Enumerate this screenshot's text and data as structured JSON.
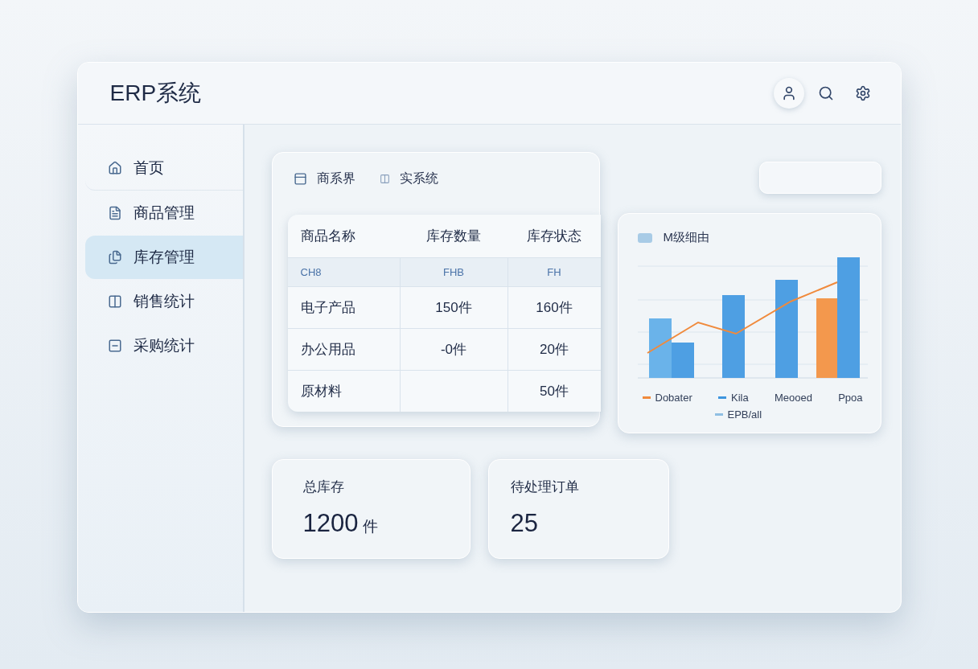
{
  "window": {
    "title": "ERP系统"
  },
  "sidebar": {
    "items": [
      {
        "label": "首页",
        "selected": false
      },
      {
        "label": "商品管理",
        "selected": false
      },
      {
        "label": "库存管理",
        "selected": true
      },
      {
        "label": "销售统计",
        "selected": false
      },
      {
        "label": "采购统计",
        "selected": false
      }
    ]
  },
  "panel": {
    "title": "商系界",
    "subtitle": "实系统"
  },
  "table": {
    "columns": [
      "商品名称",
      "库存数量",
      "库存状态"
    ],
    "subheader": [
      "CH8",
      "FHB",
      "FH"
    ],
    "rows": [
      [
        "电子产品",
        "150件",
        "160件"
      ],
      [
        "办公用品",
        "-0件",
        "20件"
      ],
      [
        "原材料",
        "",
        "50件"
      ]
    ]
  },
  "chart_card": {
    "title": "M级细由",
    "legend": [
      {
        "label": "Dobater",
        "color": "#f08a3c"
      },
      {
        "label": "Kila",
        "color": "#3d95de"
      },
      {
        "label": "Meooed"
      },
      {
        "label": "Ppoa"
      },
      {
        "label": "EPB/all",
        "color": "#8fbfe3"
      }
    ]
  },
  "stats": [
    {
      "label": "总库存",
      "value": "1200",
      "unit": "件"
    },
    {
      "label": "待处理订单",
      "value": "25"
    }
  ]
}
